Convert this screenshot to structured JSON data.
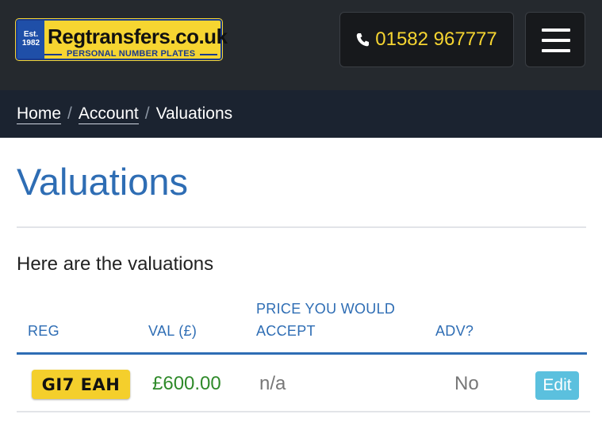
{
  "header": {
    "logo": {
      "est_line1": "Est.",
      "est_line2": "1982",
      "name": "Regtransfers.co.uk",
      "tagline": "PERSONAL NUMBER PLATES"
    },
    "phone": {
      "icon": "phone-icon",
      "number": "01582 967777"
    },
    "menu": {
      "icon": "hamburger-menu-icon"
    }
  },
  "breadcrumb": {
    "items": [
      {
        "label": "Home"
      },
      {
        "label": "Account"
      },
      {
        "label": "Valuations"
      }
    ],
    "separator": "/"
  },
  "page": {
    "title": "Valuations",
    "intro": "Here are the valuations"
  },
  "table": {
    "headers": {
      "reg": "REG",
      "val": "VAL (£)",
      "price_line1": "PRICE YOU WOULD",
      "price_line2": "ACCEPT",
      "adv": "ADV?"
    },
    "rows": [
      {
        "reg": "GI7 EAH",
        "val": "£600.00",
        "price": "n/a",
        "adv": "No",
        "action": "Edit"
      }
    ]
  },
  "colors": {
    "header_bg": "#25292e",
    "breadcrumb_bg": "#1b2330",
    "accent_blue": "#2e6db4",
    "plate_yellow": "#f4cf2c",
    "phone_yellow": "#f6d531",
    "value_green": "#2f8a2a",
    "edit_button": "#5bc0de"
  }
}
